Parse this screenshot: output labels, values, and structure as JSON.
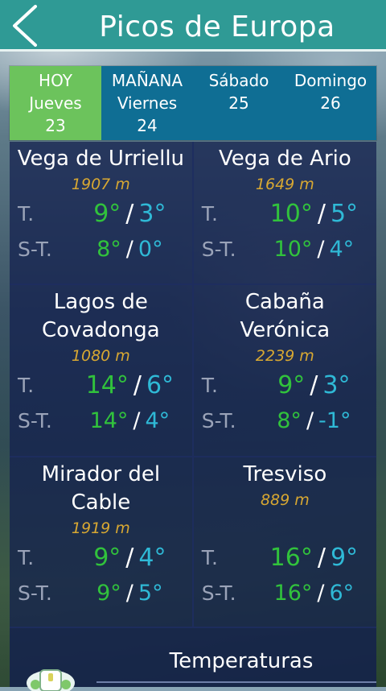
{
  "header": {
    "title": "Picos de Europa",
    "back_icon": "chevron-left-icon"
  },
  "days": [
    {
      "top": "HOY",
      "weekday": "Jueves",
      "date": "23",
      "active": true
    },
    {
      "top": "MAÑANA",
      "weekday": "Viernes",
      "date": "24",
      "active": false
    },
    {
      "top": "",
      "weekday": "Sábado",
      "date": "25",
      "active": false
    },
    {
      "top": "",
      "weekday": "Domingo",
      "date": "26",
      "active": false
    }
  ],
  "labels": {
    "t": "T.",
    "st": "S-T.",
    "sep": "/"
  },
  "locations": [
    {
      "name": "Vega de Urriellu",
      "altitude": "1907 m",
      "t_max": "9°",
      "t_min": "3°",
      "st_max": "8°",
      "st_min": "0°"
    },
    {
      "name": "Vega de Ario",
      "altitude": "1649 m",
      "t_max": "10°",
      "t_min": "5°",
      "st_max": "10°",
      "st_min": "4°"
    },
    {
      "name": "Lagos de Covadonga",
      "altitude": "1080 m",
      "t_max": "14°",
      "t_min": "6°",
      "st_max": "14°",
      "st_min": "4°"
    },
    {
      "name": "Cabaña Verónica",
      "altitude": "2239 m",
      "t_max": "9°",
      "t_min": "3°",
      "st_max": "8°",
      "st_min": "-1°"
    },
    {
      "name": "Mirador del Cable",
      "altitude": "1919 m",
      "t_max": "9°",
      "t_min": "4°",
      "st_max": "9°",
      "st_min": "5°"
    },
    {
      "name": "Tresviso",
      "altitude": "889 m",
      "t_max": "16°",
      "t_min": "9°",
      "st_max": "16°",
      "st_min": "6°"
    }
  ],
  "footer": {
    "title": "Temperaturas"
  },
  "colors": {
    "header": "#2f9a95",
    "active_day": "#6cc35c",
    "day_bar": "#0f6e94",
    "max": "#31c23c",
    "min": "#2fb9d6",
    "altitude": "#d8a832"
  }
}
